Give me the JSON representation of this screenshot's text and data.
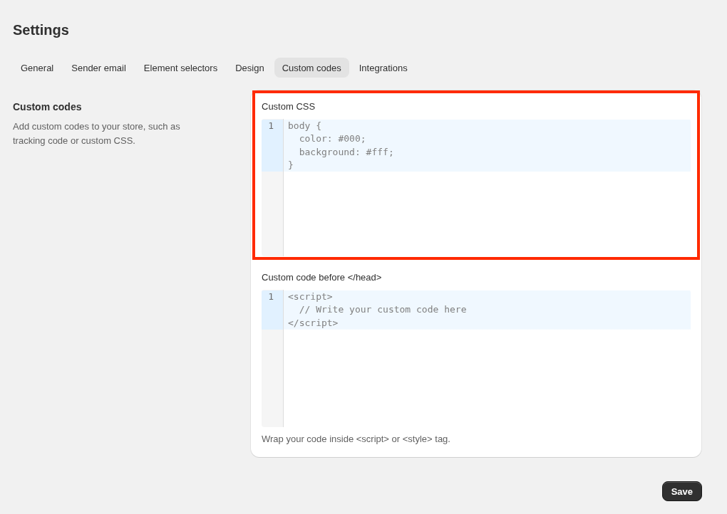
{
  "page": {
    "title": "Settings"
  },
  "tabs": [
    {
      "label": "General",
      "selected": false
    },
    {
      "label": "Sender email",
      "selected": false
    },
    {
      "label": "Element selectors",
      "selected": false
    },
    {
      "label": "Design",
      "selected": false
    },
    {
      "label": "Custom codes",
      "selected": true
    },
    {
      "label": "Integrations",
      "selected": false
    }
  ],
  "section": {
    "title": "Custom codes",
    "description": "Add custom codes to your store, such as tracking code or custom CSS."
  },
  "editors": [
    {
      "label": "Custom CSS",
      "lines": [
        {
          "number": "1",
          "active": true
        }
      ],
      "placeholder": "body {\n  color: #000;\n  background: #fff;\n}",
      "highlighted": true
    },
    {
      "label": "Custom code before </head>",
      "lines": [
        {
          "number": "1",
          "active": true
        }
      ],
      "placeholder": "<script>\n  // Write your custom code here\n</script>",
      "highlighted": false,
      "hint": "Wrap your code inside <script> or <style> tag."
    }
  ],
  "save_button": {
    "label": "Save"
  }
}
